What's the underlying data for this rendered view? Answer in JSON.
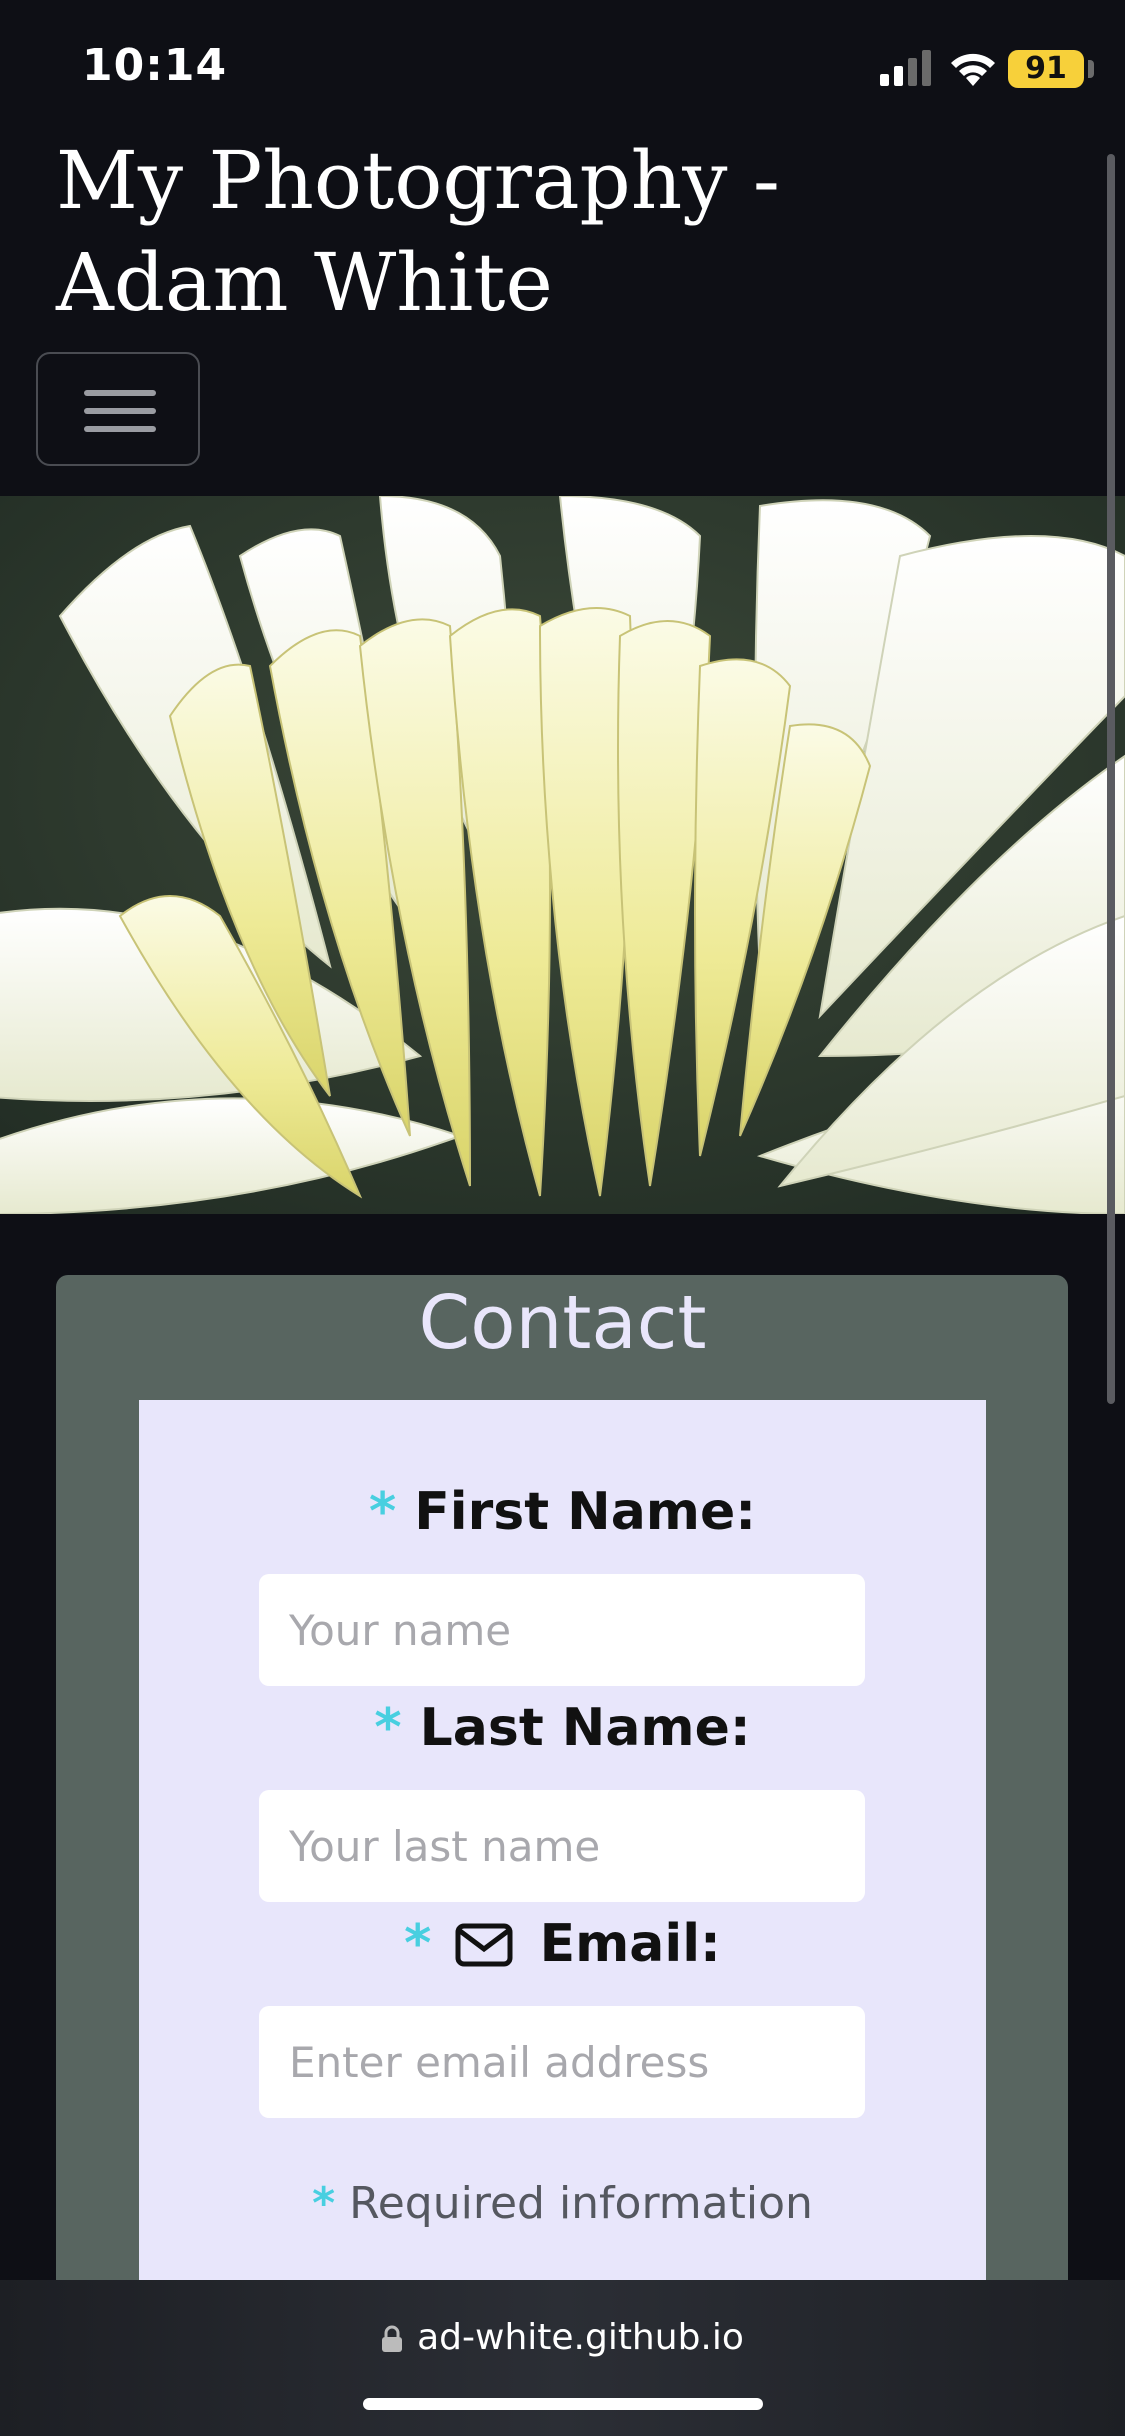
{
  "status_bar": {
    "time": "10:14",
    "battery": "91"
  },
  "header": {
    "site_title": "My Photography - Adam White"
  },
  "hero": {
    "icon": "dahlia-flower-photo"
  },
  "contact": {
    "heading": "Contact",
    "required_marker": "*",
    "first_name": {
      "label": "First Name:",
      "placeholder": "Your name"
    },
    "last_name": {
      "label": "Last Name:",
      "placeholder": "Your last name"
    },
    "email": {
      "label": "Email:",
      "placeholder": "Enter email address"
    },
    "required_note": "Required information"
  },
  "browser": {
    "url": "ad-white.github.io"
  },
  "colors": {
    "accent": "#48cfe0",
    "card": "#586560",
    "panel": "#e8e6fb",
    "background": "#0e0f15"
  }
}
